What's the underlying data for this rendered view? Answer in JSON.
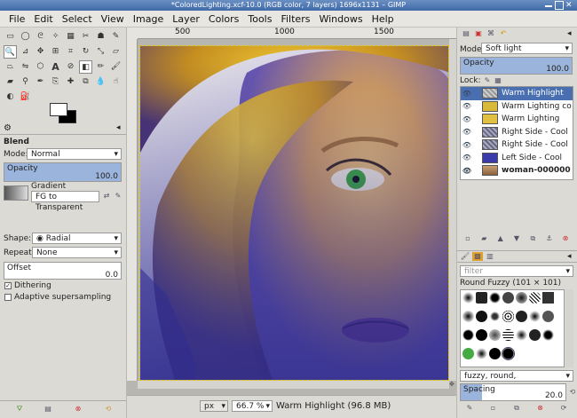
{
  "window": {
    "title": "*ColoredLighting.xcf-10.0 (RGB color, 7 layers) 1696x1131 – GIMP"
  },
  "menubar": [
    "File",
    "Edit",
    "Select",
    "View",
    "Image",
    "Layer",
    "Colors",
    "Tools",
    "Filters",
    "Windows",
    "Help"
  ],
  "tool_options": {
    "title": "Blend",
    "mode_label": "Mode:",
    "mode_value": "Normal",
    "opacity_label": "Opacity",
    "opacity_value": "100.0",
    "gradient_label": "Gradient",
    "gradient_value": "FG to Transparent",
    "shape_label": "Shape:",
    "shape_value": "Radial",
    "repeat_label": "Repeat:",
    "repeat_value": "None",
    "offset_label": "Offset",
    "offset_value": "0.0",
    "dithering_label": "Dithering",
    "dithering_checked": true,
    "supersampling_label": "Adaptive supersampling",
    "supersampling_checked": false
  },
  "ruler": {
    "marks": [
      "500",
      "1000",
      "1500"
    ]
  },
  "statusbar": {
    "unit": "px",
    "zoom": "66.7 %",
    "message": "Warm Highlight (96.8 MB)"
  },
  "layers_panel": {
    "mode_label": "Mode:",
    "mode_value": "Soft light",
    "opacity_label": "Opacity",
    "opacity_value": "100.0",
    "lock_label": "Lock:",
    "layers": [
      {
        "name": "Warm Highlight",
        "visible": true,
        "selected": true
      },
      {
        "name": "Warm Lighting co",
        "visible": true,
        "selected": false
      },
      {
        "name": "Warm Lighting",
        "visible": true,
        "selected": false
      },
      {
        "name": "Right Side - Cool",
        "visible": true,
        "selected": false
      },
      {
        "name": "Right Side - Cool",
        "visible": true,
        "selected": false
      },
      {
        "name": "Left Side - Cool",
        "visible": true,
        "selected": false
      },
      {
        "name": "woman-000000",
        "visible": true,
        "selected": false
      }
    ]
  },
  "brushes_panel": {
    "filter_placeholder": "filter",
    "brush_title": "Round Fuzzy (101 × 101)",
    "tags_value": "fuzzy, round,",
    "spacing_label": "Spacing",
    "spacing_value": "20.0"
  },
  "colors": {
    "selection": "#4a6fb0",
    "titlebar": "#3f6aa8",
    "accent": "#9bb4dc"
  }
}
